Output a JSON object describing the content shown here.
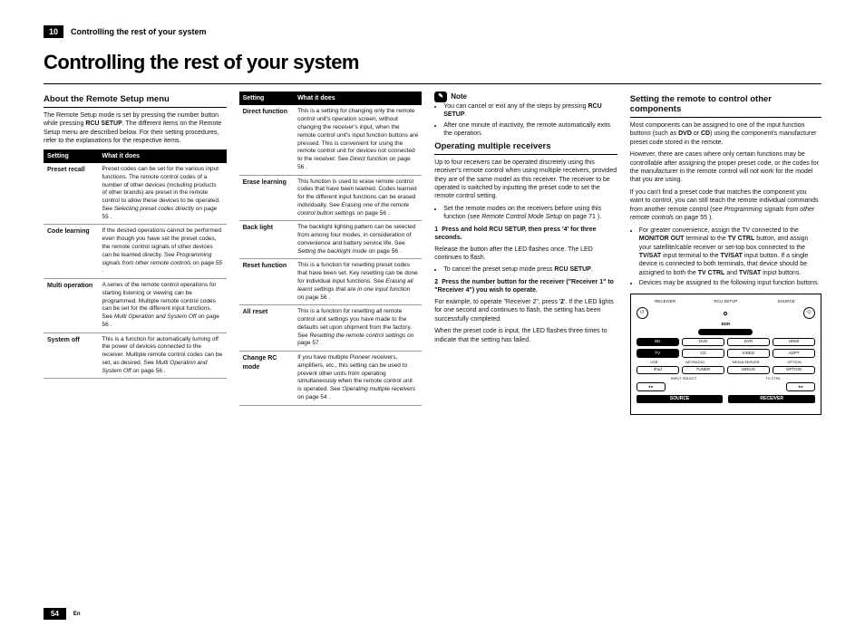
{
  "chapter": {
    "num": "10",
    "title": "Controlling the rest of your system"
  },
  "main_title": "Controlling the rest of your system",
  "col1": {
    "h1": "About the Remote Setup menu",
    "p1": "The Remote Setup mode is set by pressing the number button while pressing RCU SETUP. The different items on the Remote Setup menu are described below. For their setting procedures, refer to the explanations for the respective items.",
    "th1": "Setting",
    "th2": "What it does",
    "rows": [
      {
        "k": "Preset recall",
        "v": "Preset codes can be set for the various input functions. The remote control codes of a number of other devices (including products of other brands) are preset in the remote control to allow these devices to be operated. See Selecting preset codes directly on page 55 ."
      },
      {
        "k": "Code learning",
        "v": "If the desired operations cannot be performed even though you have set the preset codes, the remote control signals of other devices can be learned directly. See Programming signals from other remote controls on page 55 ."
      },
      {
        "k": "Multi operation",
        "v": "A series of the remote control operations for starting listening or viewing can be programmed. Multiple remote control codes can be set for the different input functions. See Multi Operation and System Off on page 56 ."
      },
      {
        "k": "System off",
        "v": "This is a function for automatically turning off the power of devices connected to the receiver. Multiple remote control codes can be set, as desired. See Multi Operation and System Off on page 56 ."
      }
    ]
  },
  "col2": {
    "th1": "Setting",
    "th2": "What it does",
    "rows": [
      {
        "k": "Direct function",
        "v": "This is a setting for changing only the remote control unit's operation screen, without changing the receiver's input, when the remote control unit's input function buttons are pressed. This is convenient for using the remote control unit for devices not connected to the receiver. See Direct function on page 56 ."
      },
      {
        "k": "Erase learning",
        "v": "This function is used to erase remote control codes that have been learned. Codes learned for the different input functions can be erased individually. See Erasing one of the remote control button settings on page 56 ."
      },
      {
        "k": "Back light",
        "v": "The backlight lighting pattern can be selected from among four modes, in consideration of convenience and battery service life. See Setting the backlight mode on page 56 ."
      },
      {
        "k": "Reset function",
        "v": "This is a function for resetting preset codes that have been set. Key resetting can be done for individual input functions. See Erasing all learnt settings that are in one input function on page 56 ."
      },
      {
        "k": "All reset",
        "v": "This is a function for resetting all remote control unit settings you have made to the defaults set upon shipment from the factory. See Resetting the remote control settings on page 57 ."
      },
      {
        "k": "Change RC mode",
        "v": "If you have multiple Pioneer receivers, amplifiers, etc., this setting can be used to prevent other units from operating simultaneously when the remote control unit is operated. See Operating multiple receivers on page 54 ."
      }
    ]
  },
  "col3": {
    "note_label": "Note",
    "note_bullets": [
      "You can cancel or exit any of the steps by pressing RCU SETUP.",
      "After one minute of inactivity, the remote automatically exits the operation."
    ],
    "h1": "Operating multiple receivers",
    "p1": "Up to four receivers can be operated discretely using this receiver's remote control when using multiple receivers, provided they are of the same model as this receiver. The receiver to be operated is switched by inputting the preset code to set the remote control setting.",
    "b1": "Set the remote modes on the receivers before using this function (see Remote Control Mode Setup on page 71 ).",
    "s1n": "1",
    "s1t": "Press and hold RCU SETUP, then press '4' for three seconds.",
    "s1p": "Release the button after the LED flashes once. The LED continues to flash.",
    "s1b": "To cancel the preset setup mode press RCU SETUP.",
    "s2n": "2",
    "s2t": "Press the number button for the receiver (\"Receiver 1\" to \"Receiver 4\") you wish to operate.",
    "s2p1": "For example, to operate \"Receiver 2\", press '2'. If the LED lights for one second and continues to flash, the setting has been successfully completed.",
    "s2p2": "When the preset code is input, the LED flashes three times to indicate that the setting has failed."
  },
  "col4": {
    "h1": "Setting the remote to control other components",
    "p1": "Most components can be assigned to one of the input function buttons (such as DVD or CD) using the component's manufacturer preset code stored in the remote.",
    "p2": "However, there are cases where only certain functions may be controllable after assigning the proper preset code, or the codes for the manufacturer in the remote control will not work for the model that you are using.",
    "p3": "If you can't find a preset code that matches the component you want to control, you can still teach the remote individual commands from another remote control (see Programming signals from other remote controls on page 55 ).",
    "b1": "For greater convenience, assign the TV connected to the MONITOR OUT terminal to the TV CTRL button, and assign your satellite/cable receiver or set-top box connected to the TV/SAT input terminal to the TV/SAT input button. If a single device is connected to both terminals, that device should be assigned to both the TV CTRL and TV/SAT input buttons.",
    "b2": "Devices may be assigned to the following input function buttons.",
    "remote": {
      "hdr_left": "RECEIVER",
      "hdr_mid": "RCU SETUP",
      "hdr_right": "SOURCE",
      "bdr": "BDR",
      "row1": [
        "BD",
        "DVD",
        "DVR",
        "HDMI"
      ],
      "row2": [
        "TV",
        "CD",
        "VIDEO",
        "ADPT"
      ],
      "row3": [
        "USB",
        "iPod",
        "TUNER",
        "NETRADIO",
        "MEDIA SERVER",
        "SIRIUS",
        "OPTION"
      ],
      "inp_lbl_l": "INPUT SELECT",
      "inp_lbl_r": "TV CTRL",
      "bottom_l": "SOURCE",
      "bottom_r": "RECEIVER"
    }
  },
  "footer": {
    "page": "54",
    "lang": "En"
  }
}
